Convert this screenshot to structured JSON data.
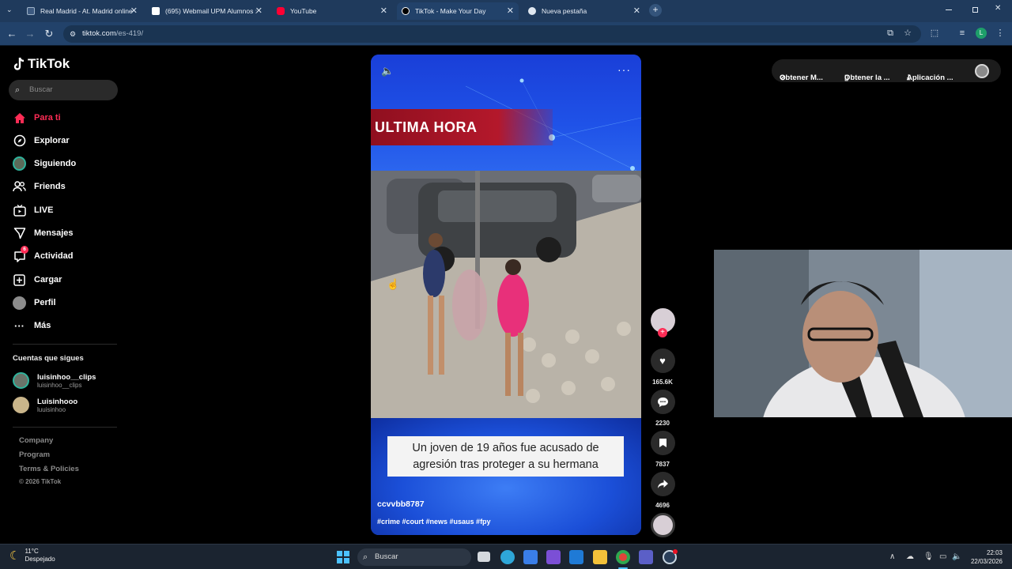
{
  "browser": {
    "tabs": [
      {
        "title": "Real Madrid - At. Madrid online",
        "close": "✕",
        "favicon_color": "#dfe7f0"
      },
      {
        "title": "(695) Webmail UPM Alumnos :",
        "close": "✕",
        "favicon_color": "#ffffff"
      },
      {
        "title": "YouTube",
        "close": "✕",
        "favicon_color": "#ff0033"
      },
      {
        "title": "TikTok - Make Your Day",
        "close": "✕",
        "favicon_color": "#000000"
      },
      {
        "title": "Nueva pestaña",
        "close": "✕",
        "favicon_color": "#dfe7f0"
      }
    ],
    "new_tab": "+",
    "url_host": "tiktok.com",
    "url_path": "/es-419/",
    "profile_initial": "L"
  },
  "tiktok": {
    "logo": "TikTok",
    "search_placeholder": "Buscar",
    "nav": [
      {
        "label": "Para ti",
        "icon": "home-icon",
        "active": true
      },
      {
        "label": "Explorar",
        "icon": "compass-icon"
      },
      {
        "label": "Siguiendo",
        "icon": "following-avatar-icon"
      },
      {
        "label": "Friends",
        "icon": "friends-icon"
      },
      {
        "label": "LIVE",
        "icon": "live-icon"
      },
      {
        "label": "Mensajes",
        "icon": "messages-icon"
      },
      {
        "label": "Actividad",
        "icon": "activity-icon",
        "badge": "6"
      },
      {
        "label": "Cargar",
        "icon": "upload-icon"
      },
      {
        "label": "Perfil",
        "icon": "profile-icon"
      },
      {
        "label": "Más",
        "icon": "more-icon"
      }
    ],
    "following_heading": "Cuentas que sigues",
    "following": [
      {
        "name": "luisinhoo__clips",
        "handle": "luisinhoo__clips"
      },
      {
        "name": "Luisinhooo",
        "handle": "luuisinhoo"
      }
    ],
    "footer": [
      "Company",
      "Program",
      "Terms & Policies"
    ],
    "copyright": "© 2026 TikTok",
    "video": {
      "banner": "ULTIMA HORA",
      "caption_line1": "Un joven de 19 años fue acusado de",
      "caption_line2": "agresión tras proteger a su hermana",
      "author": "ccvvbb8787",
      "hashtags": "#crime #court #news #usaus #fpy"
    },
    "actions": {
      "likes": "165.6K",
      "comments": "2230",
      "saves": "7837",
      "shares": "4696",
      "follow": "+"
    },
    "topbar": {
      "get_coins": "Obtener M...",
      "get_app": "Obtener la ...",
      "desktop_app": "Aplicación ..."
    }
  },
  "taskbar": {
    "temperature": "11°C",
    "condition": "Despejado",
    "search_placeholder": "Buscar",
    "time": "22:03",
    "date": "22/03/2026"
  },
  "colors": {
    "tiktok_accent": "#fe2c55",
    "browser_frame": "#22426a"
  }
}
